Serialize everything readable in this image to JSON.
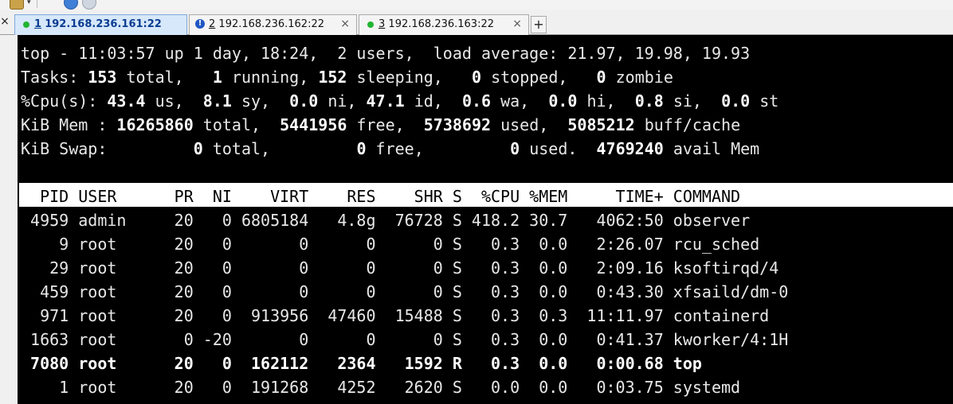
{
  "tabs": [
    {
      "number": "1",
      "address": "192.168.236.161:22",
      "status": "connected",
      "active": true
    },
    {
      "number": "2",
      "address": "192.168.236.162:22",
      "status": "warning",
      "active": false
    },
    {
      "number": "3",
      "address": "192.168.236.163:22",
      "status": "connected",
      "active": false
    }
  ],
  "tabbar": {
    "close_all": "×",
    "new_tab": "+",
    "tab_close": "×",
    "warn_glyph": "!"
  },
  "colors": {
    "terminal_bg": "#000000",
    "terminal_fg": "#e8e8e8",
    "header_bg": "#ffffff",
    "active_tab": "#d7e8fb",
    "status_green": "#21b531",
    "status_warn": "#1f56c4"
  },
  "top": {
    "summary": {
      "time": "11:03:57",
      "uptime": "1 day, 18:24",
      "users": "2",
      "load_average": [
        "21.97",
        "19.98",
        "19.93"
      ],
      "line": "top - 11:03:57 up 1 day, 18:24,  2 users,  load average: 21.97, 19.98, 19.93"
    },
    "tasks": {
      "total": "153",
      "running": "1",
      "sleeping": "152",
      "stopped": "0",
      "zombie": "0"
    },
    "cpu": {
      "us": "43.4",
      "sy": "8.1",
      "ni": "0.0",
      "id": "47.1",
      "wa": "0.6",
      "hi": "0.0",
      "si": "0.8",
      "st": "0.0"
    },
    "mem": {
      "total": "16265860",
      "free": "5441956",
      "used": "5738692",
      "buff_cache": "5085212"
    },
    "swap": {
      "total": "0",
      "free": "0",
      "used": "0",
      "avail_mem": "4769240"
    },
    "columns": [
      "PID",
      "USER",
      "PR",
      "NI",
      "VIRT",
      "RES",
      "SHR",
      "S",
      "%CPU",
      "%MEM",
      "TIME+",
      "COMMAND"
    ],
    "processes": [
      {
        "pid": "4959",
        "user": "admin",
        "pr": "20",
        "ni": "0",
        "virt": "6805184",
        "res": "4.8g",
        "shr": "76728",
        "s": "S",
        "cpu": "418.2",
        "mem": "30.7",
        "time": "4062:50",
        "command": "observer",
        "bold": false
      },
      {
        "pid": "9",
        "user": "root",
        "pr": "20",
        "ni": "0",
        "virt": "0",
        "res": "0",
        "shr": "0",
        "s": "S",
        "cpu": "0.3",
        "mem": "0.0",
        "time": "2:26.07",
        "command": "rcu_sched",
        "bold": false
      },
      {
        "pid": "29",
        "user": "root",
        "pr": "20",
        "ni": "0",
        "virt": "0",
        "res": "0",
        "shr": "0",
        "s": "S",
        "cpu": "0.3",
        "mem": "0.0",
        "time": "2:09.16",
        "command": "ksoftirqd/4",
        "bold": false
      },
      {
        "pid": "459",
        "user": "root",
        "pr": "20",
        "ni": "0",
        "virt": "0",
        "res": "0",
        "shr": "0",
        "s": "S",
        "cpu": "0.3",
        "mem": "0.0",
        "time": "0:43.30",
        "command": "xfsaild/dm-0",
        "bold": false
      },
      {
        "pid": "971",
        "user": "root",
        "pr": "20",
        "ni": "0",
        "virt": "913956",
        "res": "47460",
        "shr": "15488",
        "s": "S",
        "cpu": "0.3",
        "mem": "0.3",
        "time": "11:11.97",
        "command": "containerd",
        "bold": false
      },
      {
        "pid": "1663",
        "user": "root",
        "pr": "0",
        "ni": "-20",
        "virt": "0",
        "res": "0",
        "shr": "0",
        "s": "S",
        "cpu": "0.3",
        "mem": "0.0",
        "time": "0:41.37",
        "command": "kworker/4:1H",
        "bold": false
      },
      {
        "pid": "7080",
        "user": "root",
        "pr": "20",
        "ni": "0",
        "virt": "162112",
        "res": "2364",
        "shr": "1592",
        "s": "R",
        "cpu": "0.3",
        "mem": "0.0",
        "time": "0:00.68",
        "command": "top",
        "bold": true
      },
      {
        "pid": "1",
        "user": "root",
        "pr": "20",
        "ni": "0",
        "virt": "191268",
        "res": "4252",
        "shr": "2620",
        "s": "S",
        "cpu": "0.0",
        "mem": "0.0",
        "time": "0:03.75",
        "command": "systemd",
        "bold": false
      }
    ]
  }
}
